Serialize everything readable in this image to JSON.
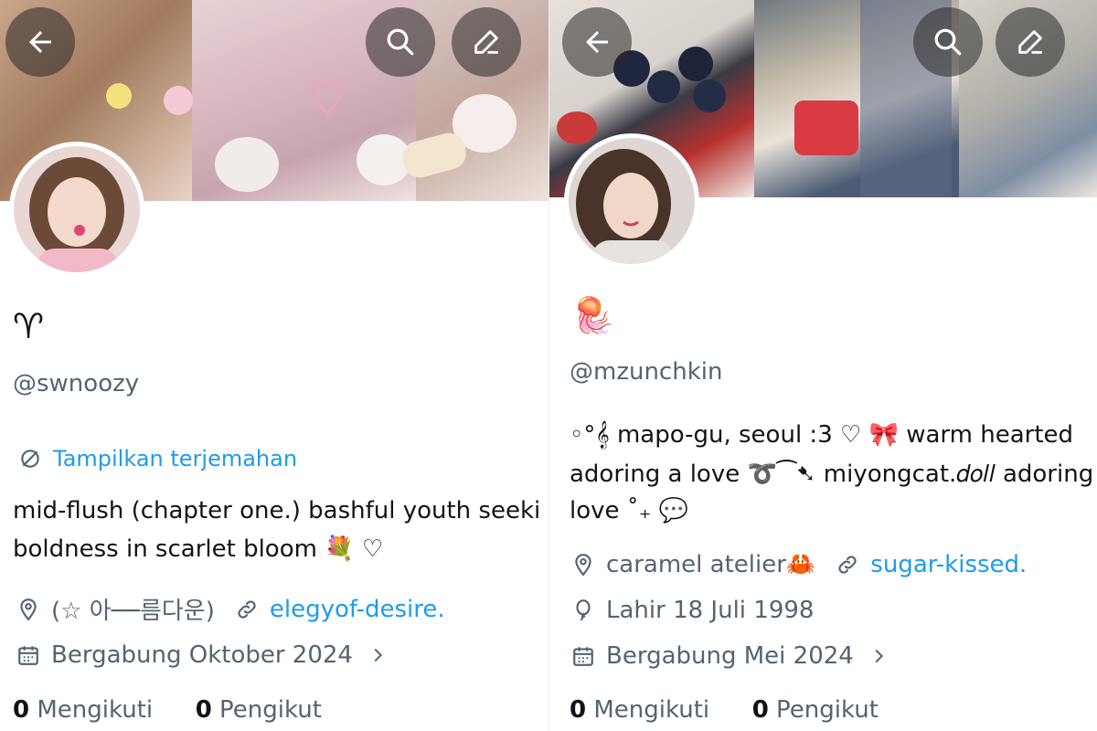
{
  "left": {
    "header": {
      "back_icon": "arrow-left-icon",
      "search_icon": "search-icon",
      "edit_icon": "pencil-icon"
    },
    "display_name": "♈",
    "handle": "@swnoozy",
    "translate_label": "Tampilkan terjemahan",
    "bio_line1": "mid-flush (chapter one.) bashful youth seeki",
    "bio_line2": "boldness in scarlet bloom 💐 ♡",
    "location": "(☆ 아──름다운)",
    "website": "elegyof-desire.",
    "joined": "Bergabung Oktober 2024",
    "following_count": "0",
    "following_label": "Mengikuti",
    "followers_count": "0",
    "followers_label": "Pengikut"
  },
  "right": {
    "header": {
      "back_icon": "arrow-left-icon",
      "search_icon": "search-icon",
      "edit_icon": "pencil-icon"
    },
    "display_name": "🪼",
    "handle": "@mzunchkin",
    "bio_line1": "◦°𝄞 mapo-gu, seoul :3 ♡ 🎀 warm hearted",
    "bio_line2": "adoring a love ➰⁀➷ miyongcat.𝑑𝑜𝑙𝑙 adoring a",
    "bio_line3": "love ˚₊ 💬",
    "location": "caramel atelier🦀",
    "website": "sugar-kissed.",
    "birthday": "Lahir 18 Juli 1998",
    "joined": "Bergabung Mei 2024",
    "following_count": "0",
    "following_label": "Mengikuti",
    "followers_count": "0",
    "followers_label": "Pengikut"
  },
  "colors": {
    "link": "#1d9bf0",
    "muted": "#536471",
    "text": "#0f1419"
  }
}
